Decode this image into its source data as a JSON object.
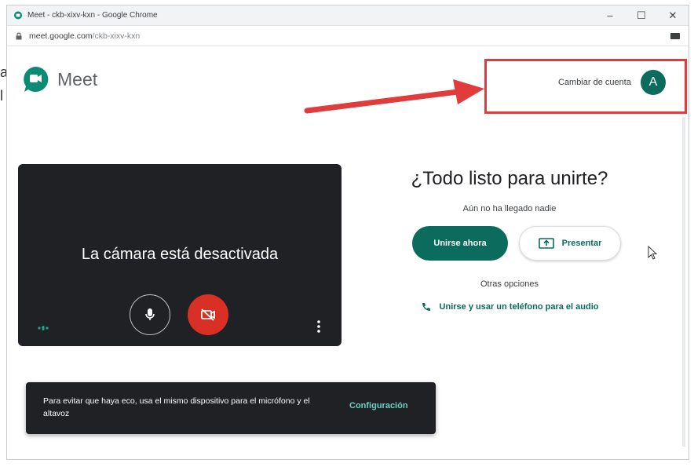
{
  "outside": {
    "line1": "a",
    "line2": "l"
  },
  "browser": {
    "title": "Meet - ckb-xixv-kxn - Google Chrome",
    "url_host": "meet.google.com",
    "url_path": "/ckb-xixv-kxn",
    "controls": {
      "minimize": "–",
      "maximize": "☐",
      "close": "✕"
    }
  },
  "brand": {
    "name": "Meet"
  },
  "account": {
    "switch_label": "Cambiar de cuenta",
    "avatar_letter": "A"
  },
  "preview": {
    "camera_off_message": "La cámara está desactivada"
  },
  "join": {
    "heading": "¿Todo listo para unirte?",
    "status": "Aún no ha llegado nadie",
    "join_button": "Unirse ahora",
    "present_button": "Presentar",
    "other_options": "Otras opciones",
    "phone_option": "Unirse y usar un teléfono para el audio"
  },
  "toast": {
    "message": "Para evitar que haya eco, usa el mismo dispositivo para el micrófono y el altavoz",
    "action": "Configuración"
  },
  "colors": {
    "accent": "#0b6b5c",
    "camera_off_red": "#d93025",
    "annotation_red": "#e03c3c",
    "toast_bg": "#202124"
  }
}
